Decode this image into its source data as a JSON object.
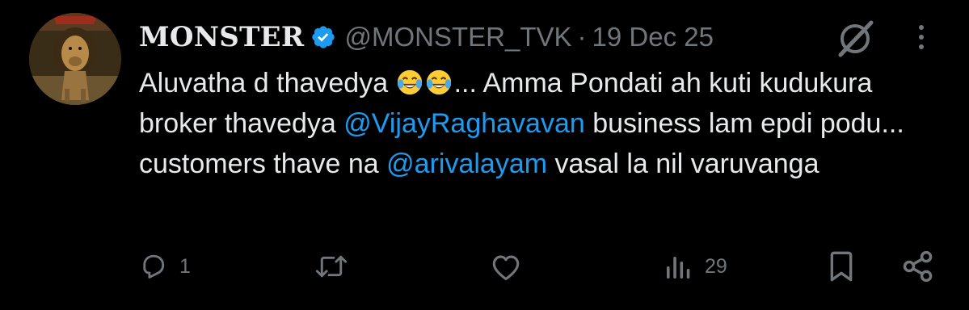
{
  "tweet": {
    "author": {
      "display_name": "MONSTER",
      "handle": "@MONSTER_TVK",
      "verified": true,
      "avatar_icon": "lion-avatar"
    },
    "separator": "·",
    "date": "19 Dec 25",
    "text": {
      "part1": "Aluvatha d thavedya ",
      "part2": "... Amma Pondati ah kuti kudukura broker thavedya ",
      "mention1": "@VijayRaghavavan",
      "part3": " business lam epdi podu... customers thave na ",
      "mention2": "@arivalayam",
      "part4": " vasal la nil varuvanga"
    },
    "emojis": [
      "face-with-tears-of-joy",
      "face-with-tears-of-joy"
    ],
    "actions": {
      "replies": "1",
      "reposts": "",
      "likes": "",
      "views": "29"
    }
  },
  "colors": {
    "background": "#000000",
    "text_primary": "#e7e9ea",
    "text_secondary": "#71767b",
    "accent_link": "#1d9bf0",
    "verified_badge": "#1d9bf0"
  },
  "icons": [
    "verified-badge-icon",
    "grok-icon",
    "more-icon",
    "reply-icon",
    "repost-icon",
    "like-icon",
    "views-icon",
    "bookmark-icon",
    "share-icon"
  ]
}
